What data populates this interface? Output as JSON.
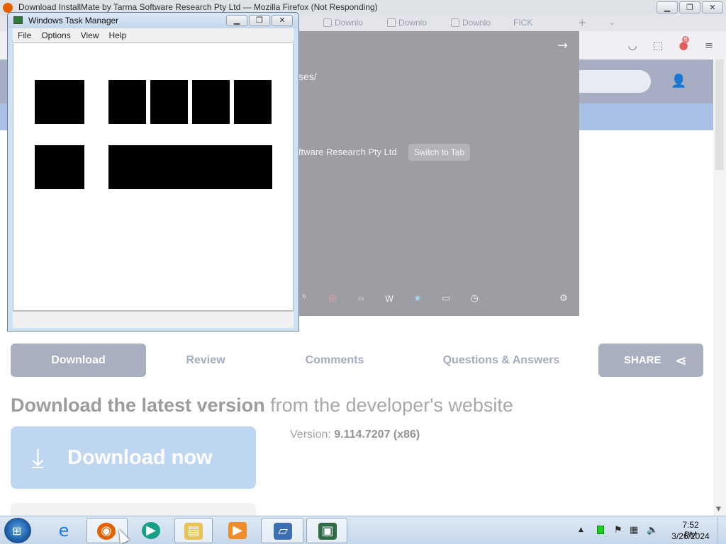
{
  "firefox": {
    "window_title": "Download InstallMate by Tarma Software Research Pty Ltd — Mozilla Firefox (Not Responding)",
    "tabs": [
      {
        "label": "Downlo"
      },
      {
        "label": "Downlo"
      },
      {
        "label": "Downlo"
      },
      {
        "label": "FICK"
      }
    ],
    "url_dropdown": {
      "url_suffix": "ses/",
      "row_text": "ftware Research Pty Ltd",
      "switch_tab_label": "Switch to Tab",
      "shortcuts": [
        "bing",
        "opera",
        "ebay",
        "wikipedia",
        "bookmarks",
        "tabs",
        "history",
        "settings"
      ]
    },
    "extension_badge": "6"
  },
  "page": {
    "nav_tabs": [
      "Download",
      "Review",
      "Comments",
      "Questions & Answers"
    ],
    "share_label": "SHARE",
    "heading_bold": "Download the latest version",
    "heading_rest": " from the developer's website",
    "version_label": "Version: ",
    "version_value": "9.114.7207 (x86)",
    "download_button": "Download now"
  },
  "taskmgr": {
    "title": "Windows Task Manager",
    "menu": [
      "File",
      "Options",
      "View",
      "Help"
    ]
  },
  "taskbar": {
    "apps": [
      "internet-explorer",
      "firefox",
      "media-app",
      "file-explorer",
      "media-player",
      "remote-desktop",
      "task-manager"
    ],
    "clock_time": "7:52 PM",
    "clock_date": "3/26/2024"
  },
  "colors": {
    "accent_blue": "#bfd6f3",
    "tab_active": "#a9afbf",
    "taskbar": "#c6d7ea"
  }
}
